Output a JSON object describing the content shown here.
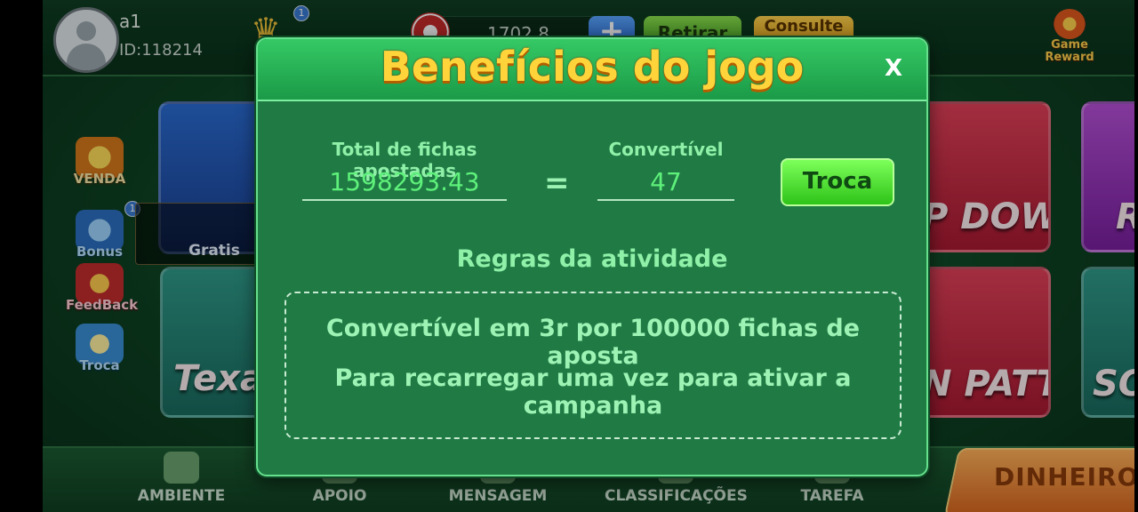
{
  "header": {
    "username": "a1",
    "user_id": "ID:118214",
    "crown_badge": "1",
    "balance": "1702.8",
    "plus_label": "+",
    "withdraw_label": "Retirar",
    "consult_label": "Consulte",
    "game_reward_label": "Game Reward"
  },
  "side_menu": {
    "venda": "VENDA",
    "bonus": "Bonus",
    "bonus_badge": "1",
    "feedback": "FeedBack",
    "troca": "Troca"
  },
  "tiles": {
    "gratis": "Gratis",
    "texas": "Texas",
    "up_down": "P DOWN",
    "teen_patti": "N PATTI",
    "rummy": "R",
    "soccer": "SO"
  },
  "bottom_nav": {
    "ambiente": "AMBIENTE",
    "apoio": "APOIO",
    "mensagem": "MENSAGEM",
    "classificacoes": "CLASSIFICAÇÕES",
    "tarefa": "TAREFA",
    "dinheiro": "DINHEIRO"
  },
  "modal": {
    "title": "Benefícios do jogo",
    "close_label": "X",
    "total_label": "Total de fichas apostadas",
    "total_value": "1598293.43",
    "equals": "=",
    "convertible_label": "Convertível",
    "convertible_value": "47",
    "exchange_button": "Troca",
    "rules_title": "Regras da atividade",
    "rule_1": "Convertível em 3r por 100000 fichas de aposta",
    "rule_2": "Para recarregar uma vez para ativar a campanha"
  },
  "colors": {
    "modal_bg": "#1f7a44",
    "title_gold": "#ffd43b",
    "value_green": "#5ef07a",
    "button_green": "#2ec318"
  }
}
